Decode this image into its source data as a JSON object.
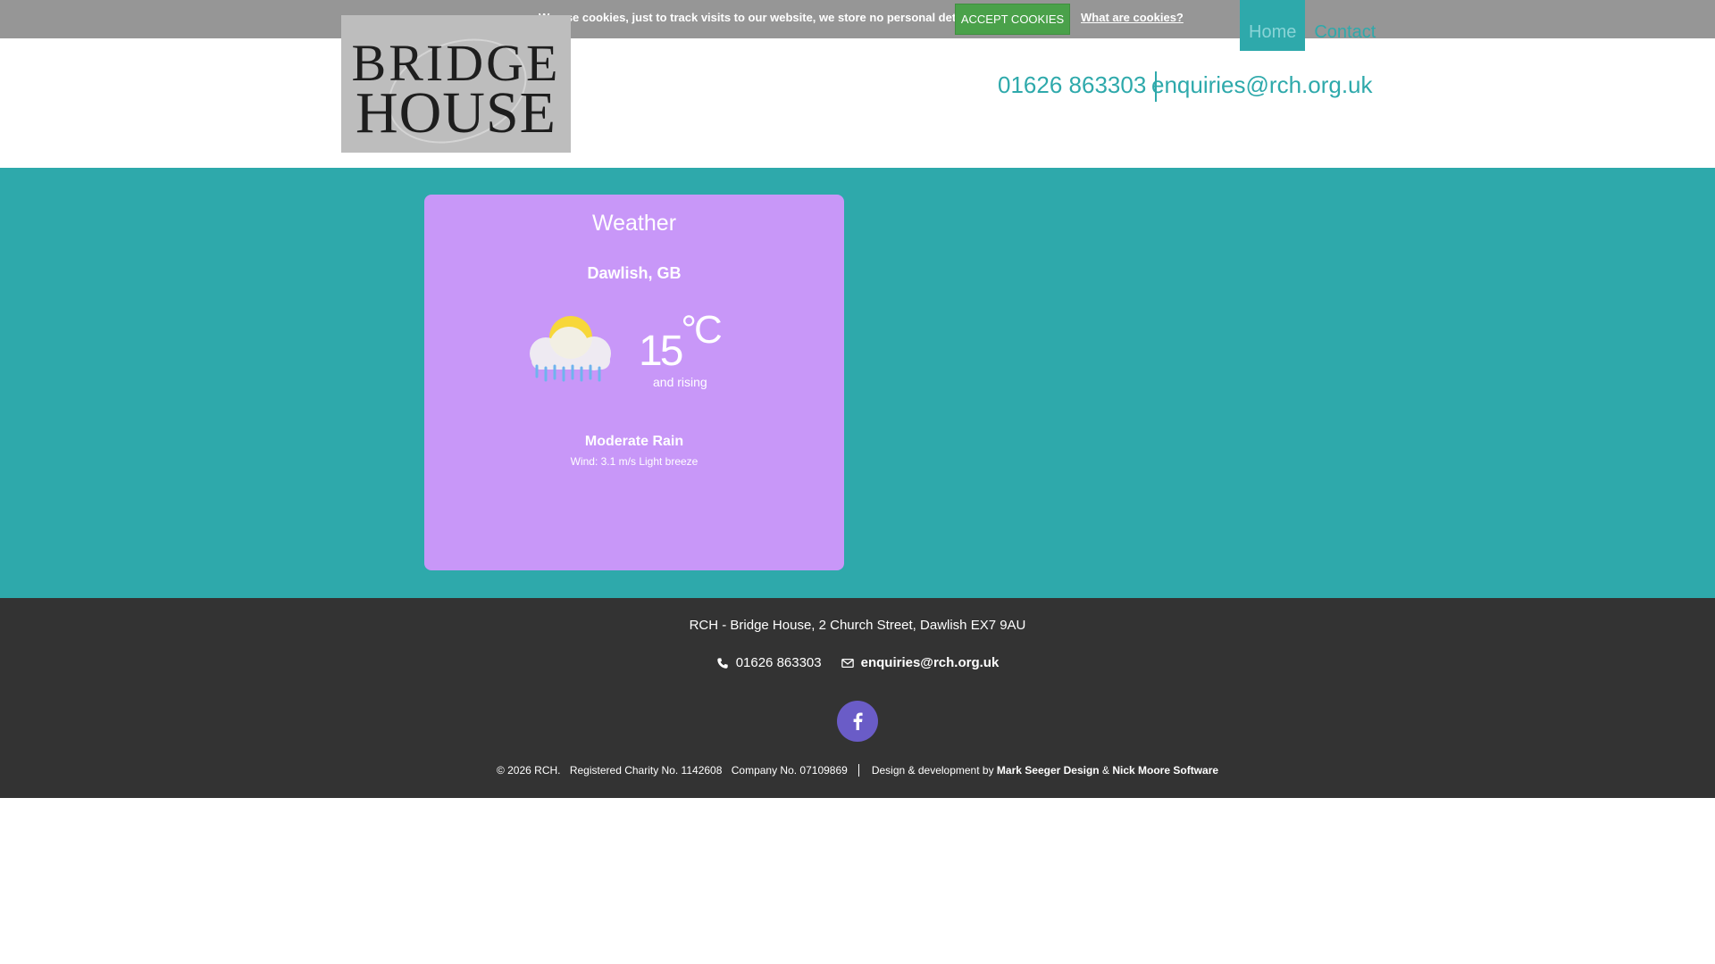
{
  "cookie_bar": {
    "message": "We use cookies, just to track visits to our website, we store no personal details.",
    "accept_label": "ACCEPT COOKIES",
    "info_link": "What are cookies?"
  },
  "logo": {
    "line1": "BRIDGE",
    "line2": "HOUSE"
  },
  "nav": {
    "items": [
      {
        "label": "Home",
        "active": true
      },
      {
        "label": "Contact",
        "active": false
      }
    ]
  },
  "header_contact": {
    "phone": "01626 863303",
    "email": "enquiries@rch.org.uk"
  },
  "weather": {
    "title": "Weather",
    "location": "Dawlish, GB",
    "temperature": "15",
    "unit": "°C",
    "trend": "and rising",
    "description": "Moderate Rain",
    "wind": "Wind: 3.1 m/s Light breeze",
    "icon": "cloud-sun-rain-icon"
  },
  "footer": {
    "address": "RCH - Bridge House, 2 Church Street, Dawlish EX7 9AU",
    "phone": "01626 863303",
    "email": "enquiries@rch.org.uk",
    "copyright": "© 2026 RCH.",
    "charity": "Registered Charity No. 1142608",
    "company": "Company No. 07109869",
    "credit_prefix": "Design & development by",
    "credit_designer": "Mark Seeger Design",
    "credit_joiner": "&",
    "credit_developer": "Nick Moore Software"
  },
  "colors": {
    "teal": "#2ea9ab",
    "card_purple": "#c897f8",
    "footer_bg": "#333333",
    "facebook": "#6a5cc7",
    "accept_green": "#4aa14a"
  }
}
